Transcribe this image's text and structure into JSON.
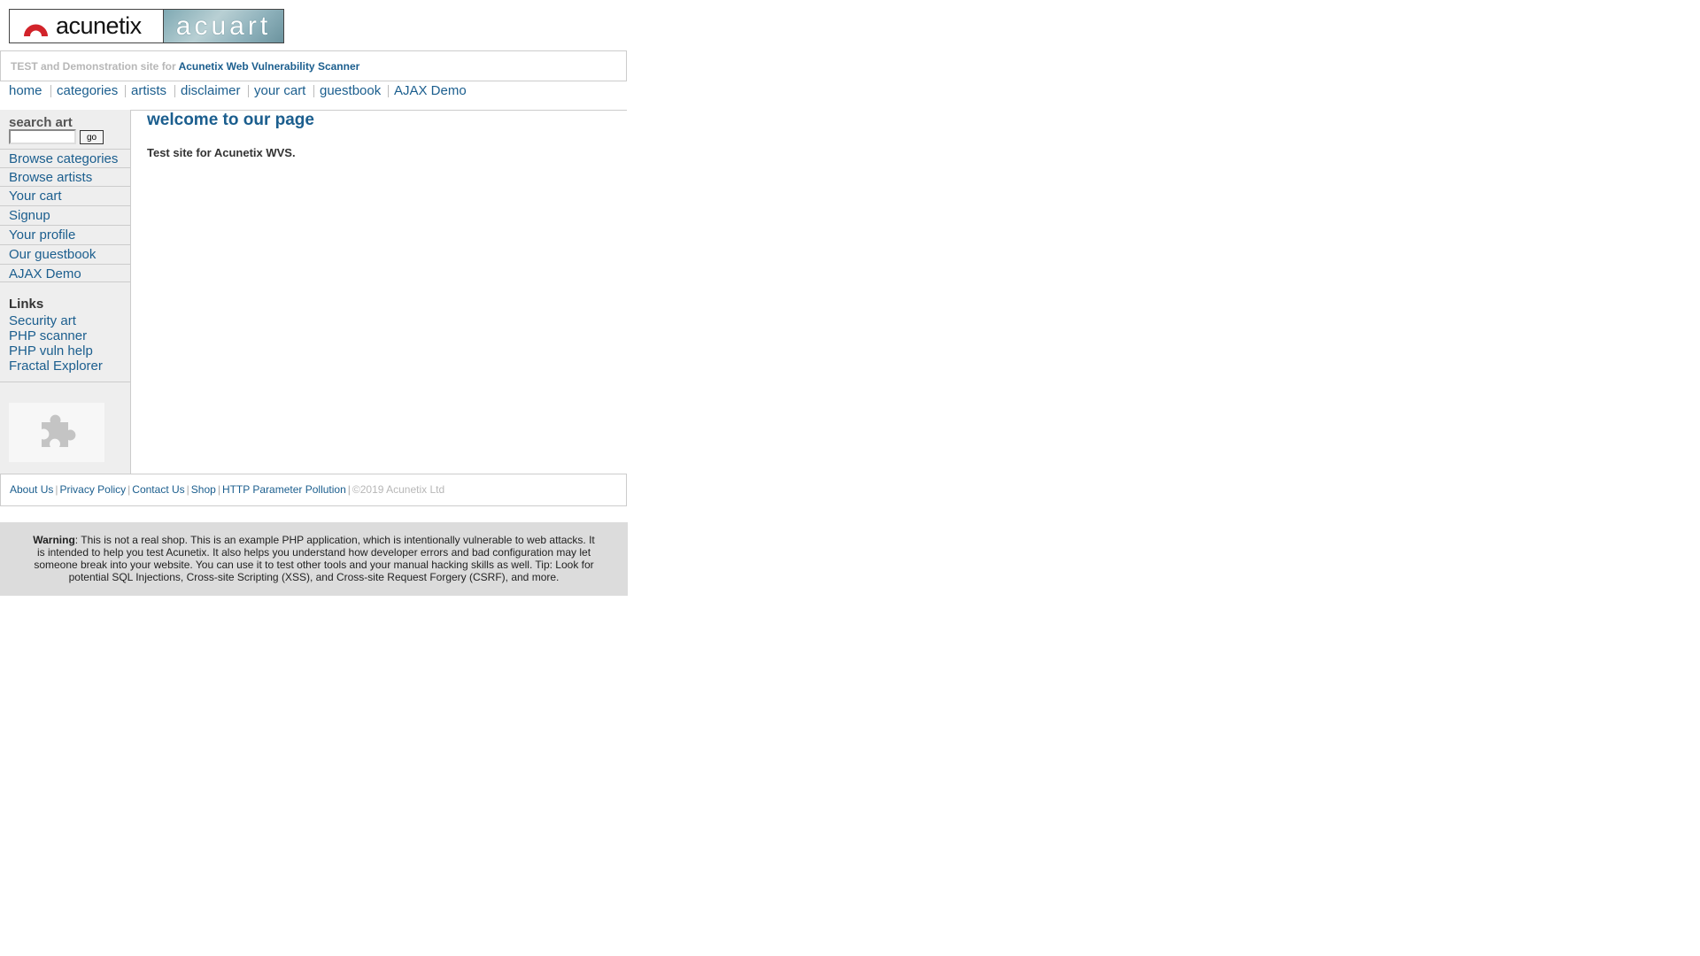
{
  "logo": {
    "brand": "acunetix",
    "product": "acuart"
  },
  "tagline": {
    "prefix": "TEST and Demonstration site for",
    "product": "Acunetix Web Vulnerability Scanner"
  },
  "menu": [
    "home",
    "categories",
    "artists",
    "disclaimer",
    "your cart",
    "guestbook",
    "AJAX Demo"
  ],
  "sidebar": {
    "search_label": "search art",
    "search_value": "",
    "go_label": "go",
    "items": [
      "Browse categories",
      "Browse artists",
      "Your cart",
      "Signup",
      "Your profile",
      "Our guestbook",
      "AJAX Demo"
    ],
    "links_title": "Links",
    "links": [
      "Security art",
      "PHP scanner",
      "PHP vuln help",
      "Fractal Explorer"
    ]
  },
  "main": {
    "title": "welcome to our page",
    "intro": "Test site for Acunetix WVS."
  },
  "footer": {
    "links": [
      "About Us",
      "Privacy Policy",
      "Contact Us",
      "Shop",
      "HTTP Parameter Pollution"
    ],
    "copyright": "©2019 Acunetix Ltd"
  },
  "warning": {
    "label": "Warning",
    "text": ": This is not a real shop. This is an example PHP application, which is intentionally vulnerable to web attacks. It is intended to help you test Acunetix. It also helps you understand how developer errors and bad configuration may let someone break into your website. You can use it to test other tools and your manual hacking skills as well. Tip: Look for potential SQL Injections, Cross-site Scripting (XSS), and Cross-site Request Forgery (CSRF), and more."
  },
  "colors": {
    "link": "#1b5e8e",
    "sidebar_bg": "#eeeeee",
    "warning_bg": "#dcdcdc",
    "muted": "#b7b7b7"
  },
  "icons": {
    "logo_mark": "acunetix-arch-icon",
    "plugin": "puzzle-piece-icon"
  }
}
